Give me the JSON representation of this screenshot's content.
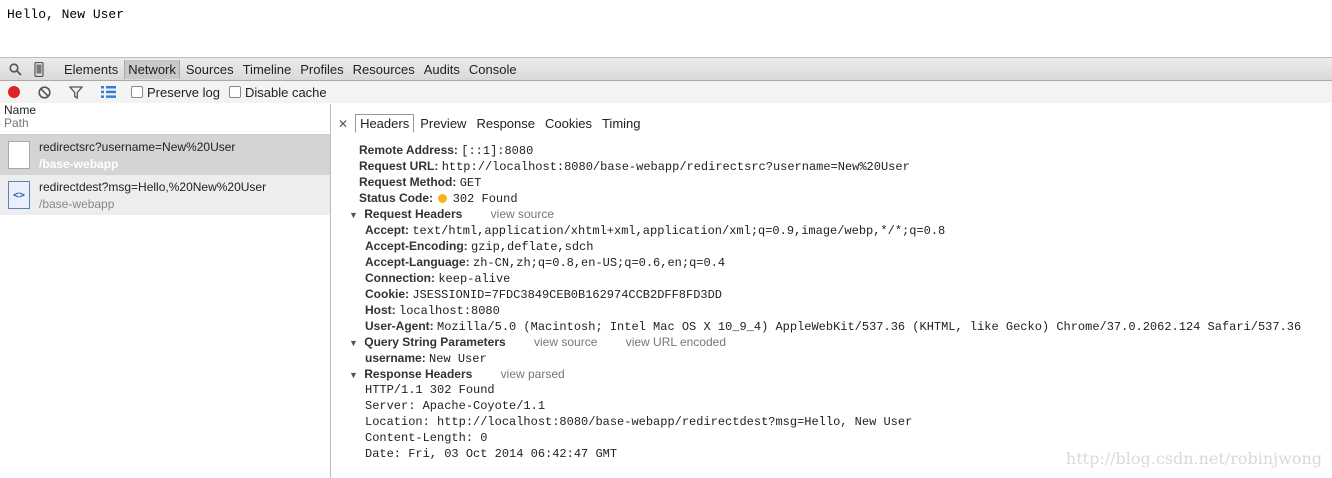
{
  "page_text": "Hello, New User",
  "devtools": {
    "tabs": [
      "Elements",
      "Network",
      "Sources",
      "Timeline",
      "Profiles",
      "Resources",
      "Audits",
      "Console"
    ],
    "toolbar": {
      "preserve_log": "Preserve log",
      "disable_cache": "Disable cache"
    },
    "list": {
      "col_name": "Name",
      "col_path": "Path",
      "requests": [
        {
          "name": "redirectsrc?username=New%20User",
          "path": "/base-webapp"
        },
        {
          "name": "redirectdest?msg=Hello,%20New%20User",
          "path": "/base-webapp"
        }
      ]
    },
    "detail_tabs": [
      "Headers",
      "Preview",
      "Response",
      "Cookies",
      "Timing"
    ],
    "general": {
      "remote_address_k": "Remote Address:",
      "remote_address_v": "[::1]:8080",
      "request_url_k": "Request URL:",
      "request_url_v": "http://localhost:8080/base-webapp/redirectsrc?username=New%20User",
      "request_method_k": "Request Method:",
      "request_method_v": "GET",
      "status_code_k": "Status Code:",
      "status_code_v": "302 Found"
    },
    "request_headers": {
      "title": "Request Headers",
      "link": "view source",
      "items": [
        {
          "k": "Accept:",
          "v": "text/html,application/xhtml+xml,application/xml;q=0.9,image/webp,*/*;q=0.8"
        },
        {
          "k": "Accept-Encoding:",
          "v": "gzip,deflate,sdch"
        },
        {
          "k": "Accept-Language:",
          "v": "zh-CN,zh;q=0.8,en-US;q=0.6,en;q=0.4"
        },
        {
          "k": "Connection:",
          "v": "keep-alive"
        },
        {
          "k": "Cookie:",
          "v": "JSESSIONID=7FDC3849CEB0B162974CCB2DFF8FD3DD"
        },
        {
          "k": "Host:",
          "v": "localhost:8080"
        },
        {
          "k": "User-Agent:",
          "v": "Mozilla/5.0 (Macintosh; Intel Mac OS X 10_9_4) AppleWebKit/537.36 (KHTML, like Gecko) Chrome/37.0.2062.124 Safari/537.36"
        }
      ]
    },
    "query_params": {
      "title": "Query String Parameters",
      "link1": "view source",
      "link2": "view URL encoded",
      "k": "username:",
      "v": "New User"
    },
    "response_headers": {
      "title": "Response Headers",
      "link": "view parsed",
      "lines": [
        "HTTP/1.1 302 Found",
        "Server: Apache-Coyote/1.1",
        "Location: http://localhost:8080/base-webapp/redirectdest?msg=Hello, New User",
        "Content-Length: 0",
        "Date: Fri, 03 Oct 2014 06:42:47 GMT"
      ]
    }
  },
  "watermark": "http://blog.csdn.net/robinjwong",
  "colors": {
    "record": "#d9252a",
    "status_dot": "#f2b51d"
  },
  "icons": [
    "search-icon",
    "mobile-device-icon",
    "record-icon",
    "clear-icon",
    "filter-icon",
    "list-view-icon",
    "close-icon",
    "document-icon",
    "html-file-icon",
    "expand-triangle-icon"
  ]
}
